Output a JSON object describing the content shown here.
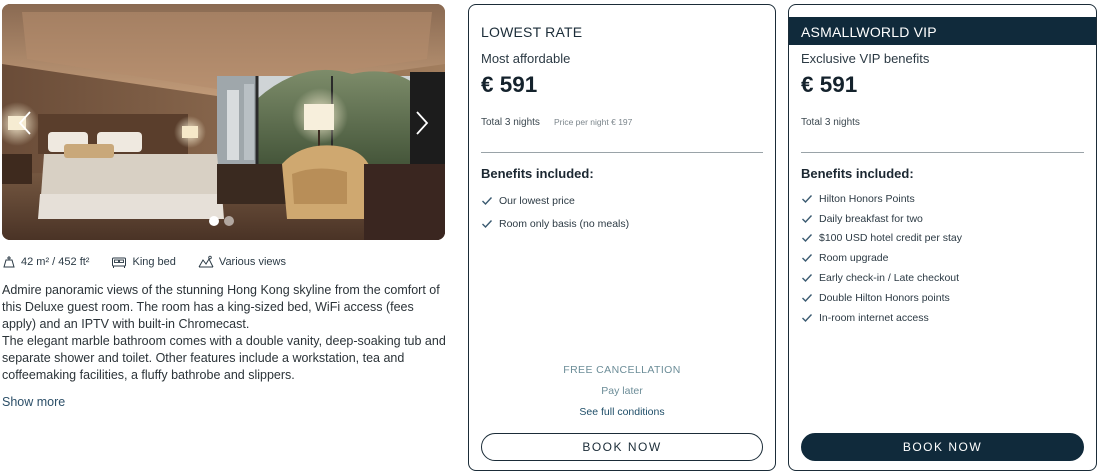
{
  "room": {
    "carousel": {
      "slide_count": 2,
      "active_slide": 1
    },
    "features": {
      "size": "42 m² / 452 ft²",
      "bed": "King bed",
      "views": "Various views"
    },
    "description": {
      "line1": "Admire panoramic views of the stunning Hong Kong skyline from the comfort of this Deluxe guest room. The room has a king-sized bed, WiFi access (fees apply) and an IPTV with built-in Chromecast.",
      "line2": "The elegant marble bathroom comes with a double vanity, deep-soaking tub and separate shower and toilet. Other features include a workstation, tea and coffeemaking facilities, a fluffy bathrobe and slippers."
    },
    "show_more": "Show more"
  },
  "lowest_rate": {
    "title": "LOWEST RATE",
    "subtitle": "Most affordable",
    "price": "€ 591",
    "total": "Total 3 nights",
    "per_night": "Price per night € 197",
    "benefits_title": "Benefits included:",
    "benefits": [
      "Our lowest price",
      "Room only basis (no meals)"
    ],
    "free_cancellation": "FREE CANCELLATION",
    "pay_later": "Pay later",
    "conditions_link": "See full conditions",
    "book_label": "BOOK NOW"
  },
  "vip_rate": {
    "title": "ASMALLWORLD VIP",
    "subtitle": "Exclusive VIP benefits",
    "price": "€ 591",
    "total": "Total 3 nights",
    "benefits_title": "Benefits included:",
    "benefits": [
      "Hilton Honors Points",
      "Daily breakfast for two",
      "$100 USD hotel credit per stay",
      "Room upgrade",
      "Early check-in / Late checkout",
      "Double Hilton Honors points",
      "In-room internet access"
    ],
    "book_label": "BOOK NOW"
  },
  "colors": {
    "navy": "#102a3b",
    "muted_teal": "#6c8d98",
    "link": "#2c4f68"
  },
  "icons": {
    "size": "floor-area-icon",
    "bed": "bed-icon",
    "views": "view-icon",
    "check": "check-icon"
  }
}
